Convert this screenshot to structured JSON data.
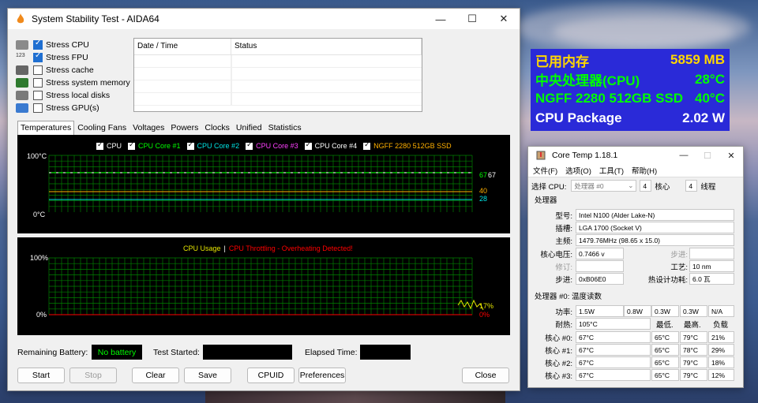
{
  "aida": {
    "title": "System Stability Test - AIDA64",
    "stress": [
      {
        "label": "Stress CPU",
        "checked": true,
        "icon": "cpu-icon",
        "color": "#8a8a8a"
      },
      {
        "label": "Stress FPU",
        "checked": true,
        "icon": "fpu-icon",
        "color": "#6a8a4a"
      },
      {
        "label": "Stress cache",
        "checked": false,
        "icon": "cache-icon",
        "color": "#666666"
      },
      {
        "label": "Stress system memory",
        "checked": false,
        "icon": "memory-icon",
        "color": "#2f7a2f"
      },
      {
        "label": "Stress local disks",
        "checked": false,
        "icon": "disk-icon",
        "color": "#7a7a7a"
      },
      {
        "label": "Stress GPU(s)",
        "checked": false,
        "icon": "gpu-icon",
        "color": "#3a7ad0"
      }
    ],
    "stress_fpu_text": "123",
    "table_headers": [
      "Date / Time",
      "Status"
    ],
    "tabs": [
      "Temperatures",
      "Cooling Fans",
      "Voltages",
      "Powers",
      "Clocks",
      "Unified",
      "Statistics"
    ],
    "temp_legend": [
      {
        "label": "CPU",
        "color": "#ffffff"
      },
      {
        "label": "CPU Core #1",
        "color": "#00ff00"
      },
      {
        "label": "CPU Core #2",
        "color": "#00e5e5"
      },
      {
        "label": "CPU Core #3",
        "color": "#ff40ff"
      },
      {
        "label": "CPU Core #4",
        "color": "#ffffff"
      },
      {
        "label": "NGFF 2280 512GB SSD",
        "color": "#ffb000"
      }
    ],
    "temp_ymax": "100°C",
    "temp_ymin": "0°C",
    "temp_values": [
      {
        "text": "67",
        "color": "#00ff00"
      },
      {
        "text": "67",
        "color": "#ffffff"
      },
      {
        "text": "40",
        "color": "#ffb000"
      },
      {
        "text": "28",
        "color": "#00e5e5"
      }
    ],
    "usage_title": "CPU Usage",
    "usage_sep": "|",
    "throttle_title": "CPU Throttling - Overheating Detected!",
    "usage_ymax": "100%",
    "usage_ymin": "0%",
    "usage_value": "17%",
    "throttle_value": "0%",
    "battery_label": "Remaining Battery:",
    "battery_value": "No battery",
    "started_label": "Test Started:",
    "elapsed_label": "Elapsed Time:",
    "buttons": {
      "start": "Start",
      "stop": "Stop",
      "clear": "Clear",
      "save": "Save",
      "cpuid": "CPUID",
      "prefs": "Preferences",
      "close": "Close"
    },
    "colors": {
      "grid": "#008000",
      "usage": "#e5e500",
      "throttle": "#ff0000"
    }
  },
  "osd": {
    "rows": [
      {
        "label": "已用内存",
        "value": "5859 MB",
        "color": "#ffd700"
      },
      {
        "label": "中央处理器(CPU)",
        "value": "28°C",
        "color": "#00ff00"
      },
      {
        "label": "NGFF 2280 512GB SSD",
        "value": "40°C",
        "color": "#00ff00"
      },
      {
        "label": "CPU Package",
        "value": "2.02 W",
        "color": "#ffffff"
      }
    ],
    "bg": "#2a2ad8"
  },
  "coretemp": {
    "title": "Core Temp 1.18.1",
    "menu": [
      "文件(F)",
      "选项(O)",
      "工具(T)",
      "帮助(H)"
    ],
    "select_cpu_label": "选择 CPU:",
    "select_cpu_value": "处理器 #0",
    "cores_count": "4",
    "cores_label": "核心",
    "threads_count": "4",
    "threads_label": "线程",
    "processor_section": "处理器",
    "model_label": "型号:",
    "model_value": "Intel N100 (Alder Lake-N)",
    "socket_label": "插槽:",
    "socket_value": "LGA 1700 (Socket V)",
    "freq_label": "主频:",
    "freq_value": "1479.76MHz (98.65 x 15.0)",
    "vid_label": "核心电压:",
    "vid_value": "0.7466 v",
    "step_label_a": "步进:",
    "rev_label": "修订:",
    "tech_label": "工艺:",
    "tech_value": "10 nm",
    "stepping_label": "步进:",
    "stepping_value": "0xB06E0",
    "tdp_label": "热设计功耗:",
    "tdp_value": "6.0 瓦",
    "temp_section": "处理器 #0: 温度读数",
    "power_label": "功率:",
    "power_values": [
      "1.5W",
      "0.8W",
      "0.3W",
      "0.3W",
      "N/A"
    ],
    "tj_label": "耐热:",
    "tj_value": "105°C",
    "col_low": "最低.",
    "col_high": "最高.",
    "col_load": "负载",
    "cores": [
      {
        "label": "核心 #0:",
        "temp": "67°C",
        "low": "65°C",
        "high": "79°C",
        "load": "21%"
      },
      {
        "label": "核心 #1:",
        "temp": "67°C",
        "low": "65°C",
        "high": "78°C",
        "load": "29%"
      },
      {
        "label": "核心 #2:",
        "temp": "67°C",
        "low": "65°C",
        "high": "79°C",
        "load": "18%"
      },
      {
        "label": "核心 #3:",
        "temp": "67°C",
        "low": "65°C",
        "high": "79°C",
        "load": "12%"
      }
    ]
  }
}
